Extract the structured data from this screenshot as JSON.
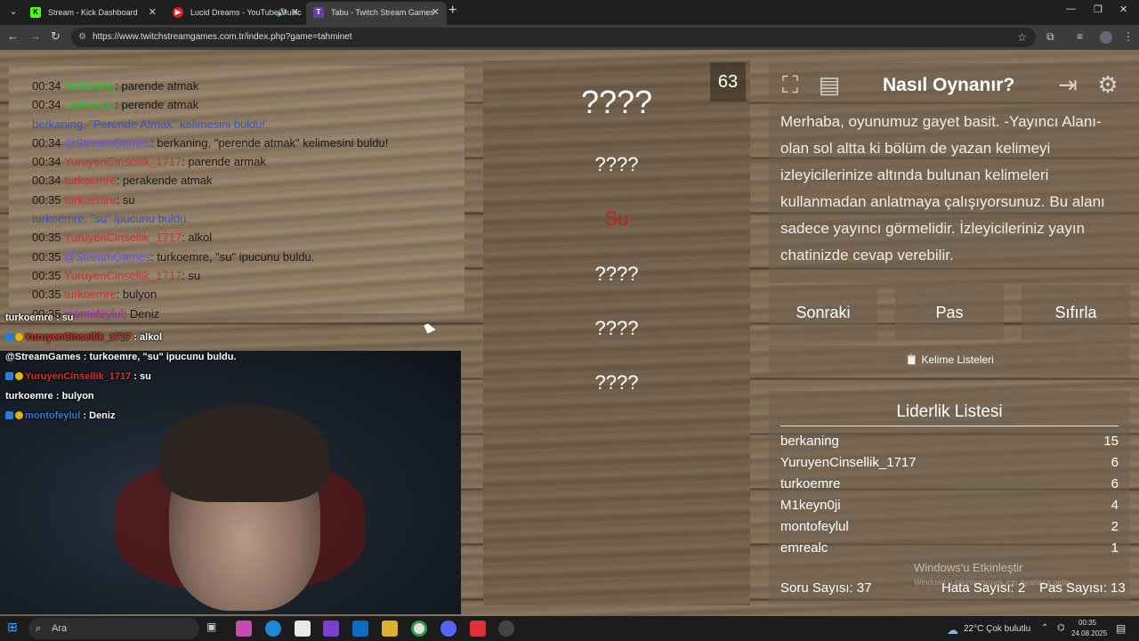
{
  "browser": {
    "tabs": [
      {
        "title": "Stream - Kick Dashboard",
        "favicon": "K",
        "color": "#53fc18"
      },
      {
        "title": "Lucid Dreams - YouTube Music",
        "favicon": "▶",
        "color": "#e02020"
      },
      {
        "title": "Tabu - Twitch Stream Games",
        "favicon": "T",
        "color": "#6441a5"
      }
    ],
    "url": "https://www.twitchstreamgames.com.tr/index.php?game=tahminet"
  },
  "chat_log": [
    {
      "time": "00:34",
      "user": "berkaning",
      "user_class": "u-green",
      "text": ": parende atmak"
    },
    {
      "time": "00:34",
      "user": "berkaning",
      "user_class": "u-green",
      "text": ": perende atmak"
    },
    {
      "system": "berkaning, \"Perende Atmak\" kelimesini buldu!."
    },
    {
      "time": "00:34",
      "user": "@StreamGames",
      "user_class": "u-blue",
      "text": ": berkaning, \"perende atmak\" kelimesini buldu!"
    },
    {
      "time": "00:34",
      "user": "YuruyenCinsellik_1717",
      "user_class": "u-red",
      "text": ": parende armak"
    },
    {
      "time": "00:34",
      "user": "turkoemre",
      "user_class": "u-red",
      "text": ": perakende atmak"
    },
    {
      "time": "00:35",
      "user": "turkoemre",
      "user_class": "u-red",
      "text": ": su"
    },
    {
      "system": "turkoemre, \"su\" ipucunu buldu."
    },
    {
      "time": "00:35",
      "user": "YuruyenCinsellik_1717",
      "user_class": "u-red",
      "text": ": alkol"
    },
    {
      "time": "00:35",
      "user": "@StreamGames",
      "user_class": "u-blue",
      "text": ": turkoemre, \"su\" ipucunu buldu."
    },
    {
      "time": "00:35",
      "user": "YuruyenCinsellik_1717",
      "user_class": "u-red",
      "text": ": su"
    },
    {
      "time": "00:35",
      "user": "turkoemre",
      "user_class": "u-red",
      "text": ": bulyon"
    },
    {
      "time": "00:35",
      "user": "montofeylul",
      "user_class": "u-purple",
      "text": ": Deniz"
    }
  ],
  "stream_chat": [
    {
      "user": "turkoemre",
      "text": ": su",
      "user_class": "",
      "badges": false
    },
    {
      "user": "YuruyenCinsellik_1717",
      "text": ": alkol",
      "user_class": "sc-red",
      "badges": true
    },
    {
      "user": "@StreamGames",
      "text": ": turkoemre, \"su\" ipucunu buldu.",
      "user_class": "",
      "badges": false
    },
    {
      "user": "YuruyenCinsellik_1717",
      "text": ": su",
      "user_class": "sc-red",
      "badges": true
    },
    {
      "user": "turkoemre",
      "text": ": bulyon",
      "user_class": "",
      "badges": false
    },
    {
      "user": "montofeylul",
      "text": ": Deniz",
      "user_class": "sc-blue",
      "badges": true
    }
  ],
  "game": {
    "timer": "63",
    "main_word": "????",
    "hints": [
      "????",
      "Su",
      "????",
      "????",
      "????"
    ],
    "found_hint_index": 1
  },
  "howto": {
    "title": "Nasıl Oynanır?",
    "text": "Merhaba, oyunumuz gayet basit. -Yayıncı Alanı- olan sol altta ki bölüm de yazan kelimeyi izleyicilerinize altında bulunan kelimeleri kullanmadan anlatmaya çalışıyorsunuz. Bu alanı sadece yayıncı görmelidir. İzleyicileriniz yayın chatinizde cevap verebilir."
  },
  "buttons": {
    "next": "Sonraki",
    "pass": "Pas",
    "reset": "Sıfırla",
    "word_lists": "📋 Kelime Listeleri"
  },
  "leaderboard": {
    "title": "Liderlik Listesi",
    "rows": [
      {
        "name": "berkaning",
        "score": "15"
      },
      {
        "name": "YuruyenCinsellik_1717",
        "score": "6"
      },
      {
        "name": "turkoemre",
        "score": "6"
      },
      {
        "name": "M1keyn0ji",
        "score": "4"
      },
      {
        "name": "montofeylul",
        "score": "2"
      },
      {
        "name": "emrealc",
        "score": "1"
      }
    ]
  },
  "stats": {
    "questions": "Soru Sayısı: 37",
    "errors": "Hata Sayısı: 2",
    "passes": "Pas Sayısı: 13"
  },
  "watermark": {
    "title": "Windows'u Etkinleştir",
    "sub": "Windows'u etkinleştirmek için Ayarlar'a gidin."
  },
  "taskbar": {
    "search": "Ara",
    "weather": "22°C  Çok bulutlu",
    "time": "00:35",
    "date": "24.08.2025"
  }
}
